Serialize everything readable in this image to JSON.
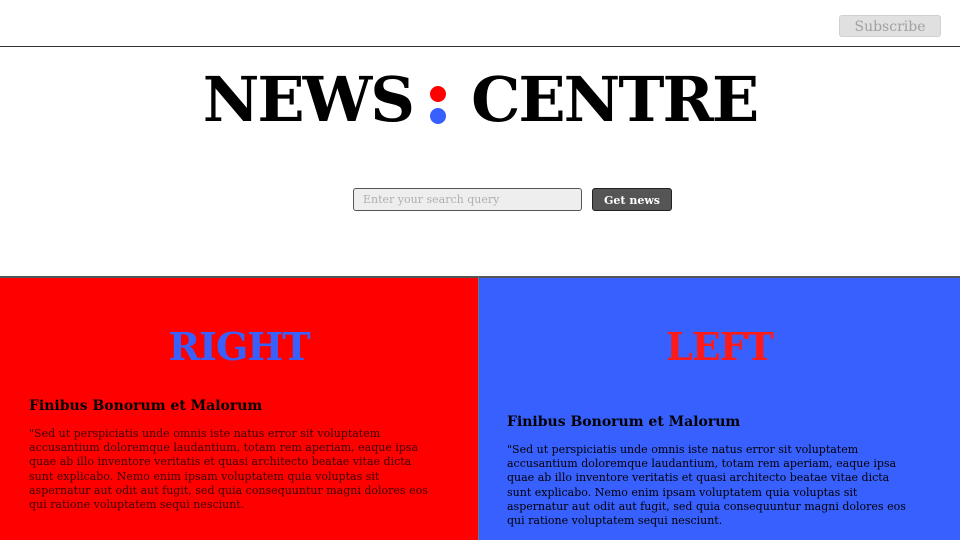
{
  "header": {
    "subscribe_label": "Subscribe"
  },
  "masthead": {
    "word_left": "NEWS",
    "word_right": "CENTRE",
    "colon_top_color": "#ff0000",
    "colon_bottom_color": "#3860ff",
    "colon_icon": "two-dot-colon-icon"
  },
  "search": {
    "placeholder": "Enter your search query",
    "value": "",
    "button_label": "Get news"
  },
  "colors": {
    "right_panel_bg": "#ff0000",
    "left_panel_bg": "#3860ff",
    "right_title_color": "#3860ff",
    "left_title_color": "#ff1a1a"
  },
  "panels": {
    "right": {
      "title": "RIGHT",
      "article_title": "Finibus Bonorum et Malorum",
      "article_body": "\"Sed ut perspiciatis unde omnis iste natus error sit voluptatem accusantium doloremque laudantium, totam rem aperiam, eaque ipsa quae ab illo inventore veritatis et quasi architecto beatae vitae dicta sunt explicabo. Nemo enim ipsam voluptatem quia voluptas sit aspernatur aut odit aut fugit, sed quia consequuntur magni dolores eos qui ratione voluptatem sequi nesciunt."
    },
    "left": {
      "title": "LEFT",
      "article_title": "Finibus Bonorum et Malorum",
      "article_body": "\"Sed ut perspiciatis unde omnis iste natus error sit voluptatem accusantium doloremque laudantium, totam rem aperiam, eaque ipsa quae ab illo inventore veritatis et quasi architecto beatae vitae dicta sunt explicabo. Nemo enim ipsam voluptatem quia voluptas sit aspernatur aut odit aut fugit, sed quia consequuntur magni dolores eos qui ratione voluptatem sequi nesciunt."
    }
  }
}
